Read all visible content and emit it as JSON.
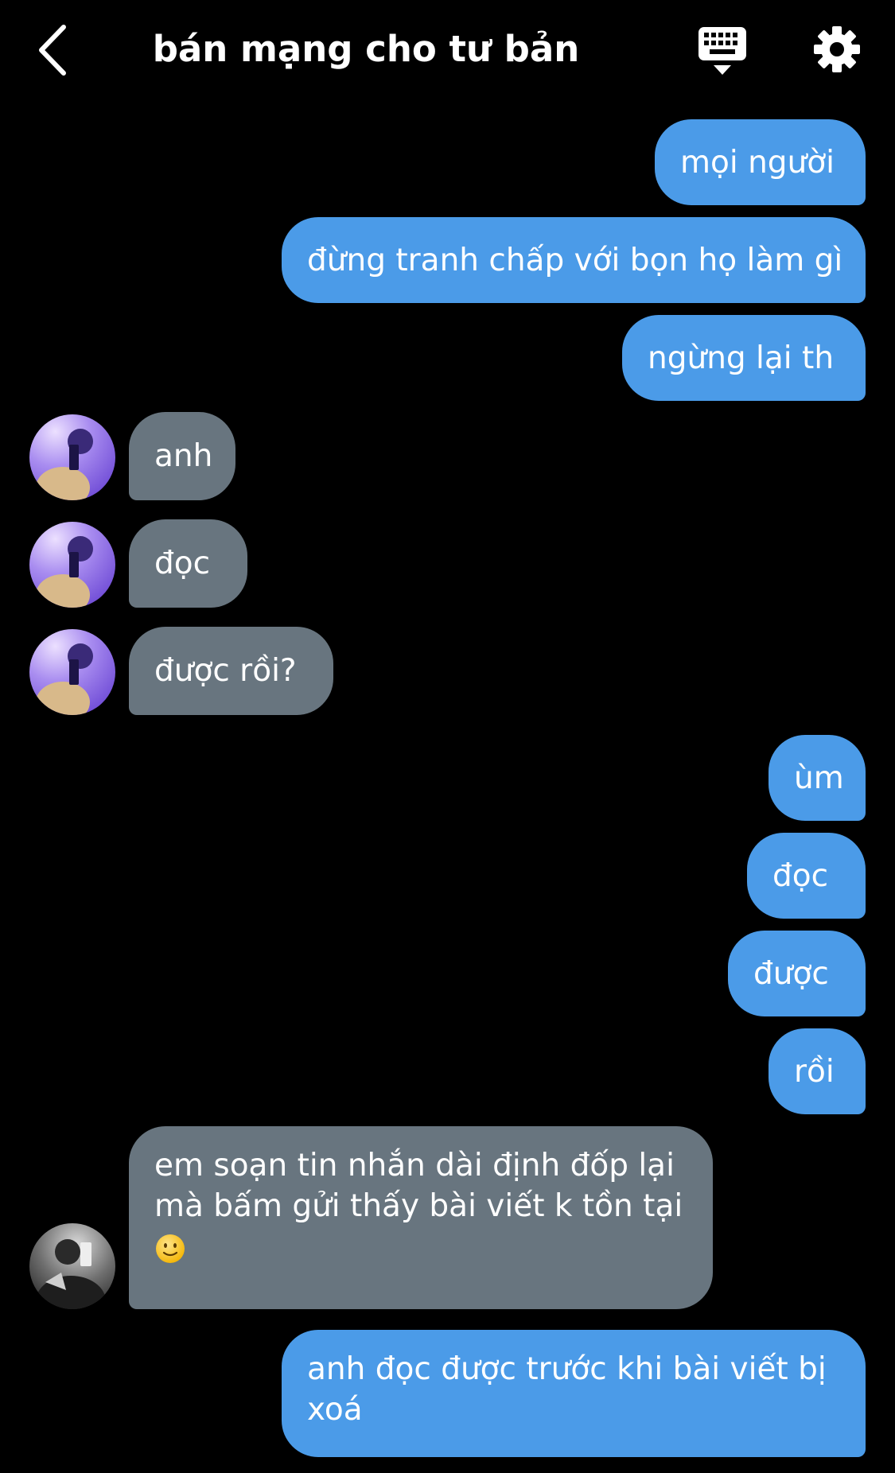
{
  "header": {
    "title": "bán mạng cho tư bản",
    "back_icon": "chevron-left-icon",
    "keyboard_icon": "keyboard-icon",
    "settings_icon": "gear-icon"
  },
  "colors": {
    "background": "#000000",
    "outgoing_bubble": "#4b9be8",
    "incoming_bubble": "#68757f"
  },
  "messages": [
    {
      "direction": "outgoing",
      "text": "mọi người"
    },
    {
      "direction": "outgoing",
      "text": "đừng tranh chấp với bọn họ làm gì"
    },
    {
      "direction": "outgoing",
      "text": "ngừng lại th"
    },
    {
      "direction": "incoming",
      "text": "anh",
      "avatar": "avatar-purple"
    },
    {
      "direction": "incoming",
      "text": "đọc",
      "avatar": "avatar-purple"
    },
    {
      "direction": "incoming",
      "text": "được rồi?",
      "avatar": "avatar-purple"
    },
    {
      "direction": "outgoing",
      "text": "ùm"
    },
    {
      "direction": "outgoing",
      "text": "đọc"
    },
    {
      "direction": "outgoing",
      "text": "được"
    },
    {
      "direction": "outgoing",
      "text": "rồi"
    },
    {
      "direction": "incoming",
      "text": "em soạn tin nhắn dài định đốp lại mà bấm gửi thấy bài viết k tồn tại",
      "emoji": "slightly-smiling-face-icon",
      "avatar": "avatar-grayscale"
    },
    {
      "direction": "outgoing",
      "text": "anh đọc được trước khi bài viết bị xoá"
    }
  ]
}
